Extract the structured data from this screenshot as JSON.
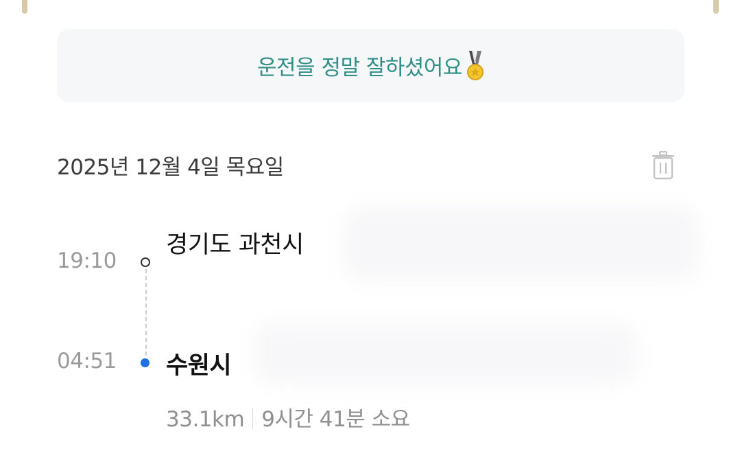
{
  "banner": {
    "message": "운전을 정말 잘하셨어요"
  },
  "trip": {
    "date": "2025년 12월 4일 목요일",
    "start": {
      "time": "19:10",
      "place": "경기도 과천시"
    },
    "end": {
      "time": "04:51",
      "place": "수원시"
    },
    "distance": "33.1km",
    "duration": "9시간 41분 소요"
  },
  "icons": {
    "banner": "medal-icon",
    "delete": "trash-icon"
  },
  "colors": {
    "banner_text": "#2f8f86",
    "banner_bg": "#f5f7f9",
    "end_dot": "#1f6fe5"
  }
}
